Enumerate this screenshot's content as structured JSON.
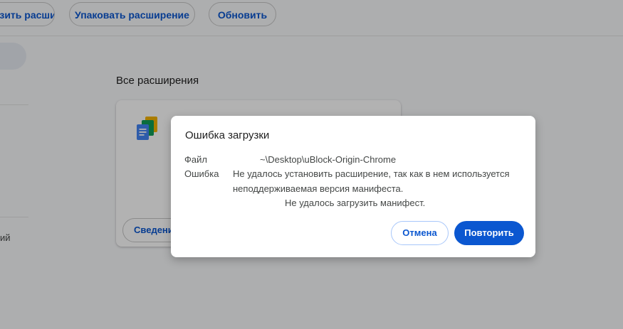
{
  "toolbar": {
    "load_label": "Загрузить расширение",
    "pack_label": "Упаковать расширение",
    "update_label": "Обновить"
  },
  "sidebar": {
    "partial_text": "ий"
  },
  "main": {
    "section_title": "Все расширения",
    "card": {
      "details_label": "Сведения"
    }
  },
  "dialog": {
    "title": "Ошибка загрузки",
    "file_label": "Файл",
    "file_value": "~\\Desktop\\uBlock-Origin-Chrome",
    "error_label": "Ошибка",
    "error_line1": "Не удалось установить расширение, так как в нем используется",
    "error_line2": "неподдерживаемая версия манифеста.",
    "error_line3": "Не удалось загрузить манифест.",
    "cancel_label": "Отмена",
    "retry_label": "Повторить"
  },
  "colors": {
    "accent": "#0b57d0",
    "page_bg": "#f8f9fb"
  }
}
